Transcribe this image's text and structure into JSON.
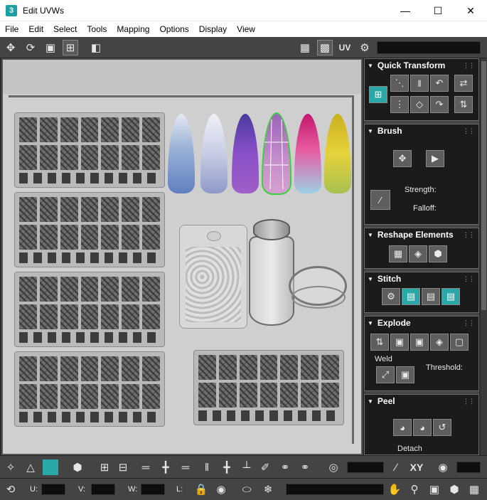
{
  "window": {
    "title": "Edit UVWs",
    "app_icon": "3"
  },
  "menu": [
    "File",
    "Edit",
    "Select",
    "Tools",
    "Mapping",
    "Options",
    "Display",
    "View"
  ],
  "toolbar": {
    "uv_label": "UV"
  },
  "panel": {
    "quick_transform": {
      "title": "Quick Transform"
    },
    "brush": {
      "title": "Brush",
      "strength_label": "Strength:",
      "falloff_label": "Falloff:"
    },
    "reshape": {
      "title": "Reshape Elements"
    },
    "stitch": {
      "title": "Stitch"
    },
    "explode": {
      "title": "Explode",
      "weld_label": "Weld",
      "threshold_label": "Threshold:"
    },
    "peel": {
      "title": "Peel",
      "detach_label": "Detach"
    }
  },
  "bottom": {
    "xy_label": "XY",
    "u_label": "U:",
    "v_label": "V:",
    "w_label": "W:",
    "l_label": "L:"
  },
  "colors": {
    "accent": "#2aa8a8",
    "panel_bg": "#1b1b1b",
    "toolbar_bg": "#444444",
    "viewport_bg": "#cfcfcf"
  }
}
